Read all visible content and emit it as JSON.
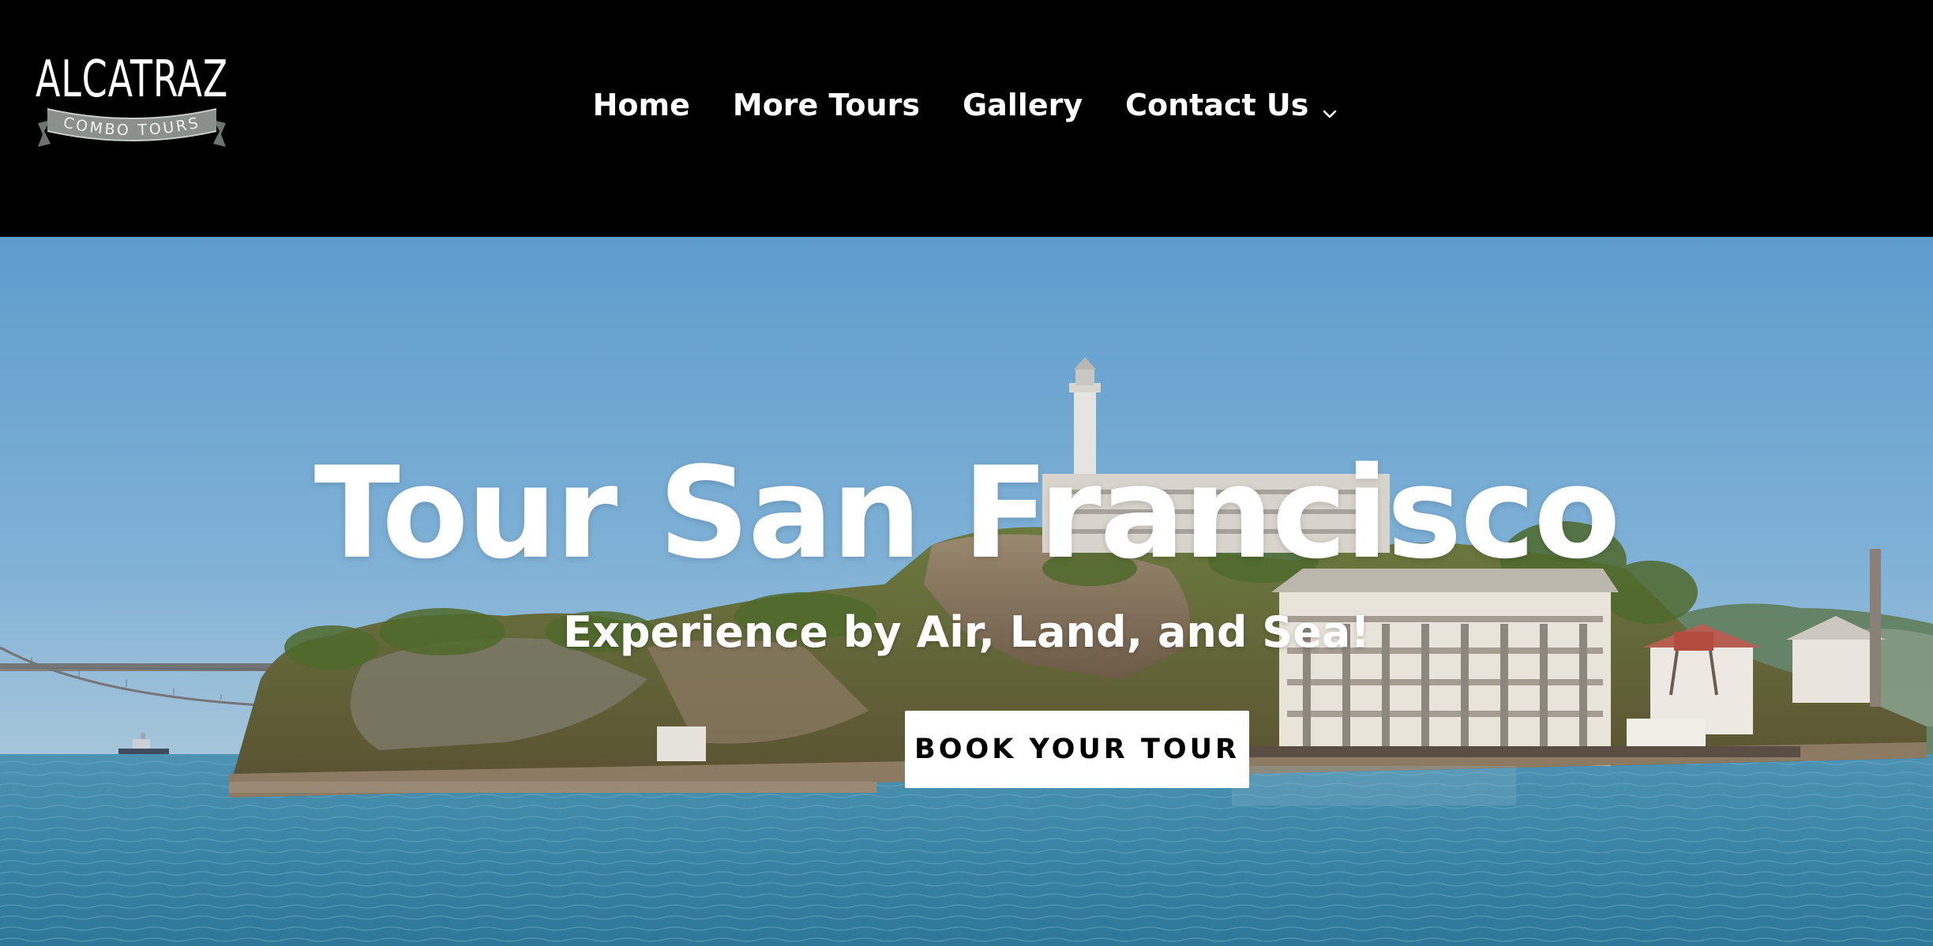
{
  "brand": {
    "logo_text": "ALCATRAZ",
    "logo_subtext": "COMBO TOURS"
  },
  "nav": {
    "items": [
      {
        "label": "Home"
      },
      {
        "label": "More Tours"
      },
      {
        "label": "Gallery"
      },
      {
        "label": "Contact Us",
        "has_dropdown": true,
        "icon": "chevron-down-icon"
      }
    ]
  },
  "hero": {
    "title": "Tour San Francisco",
    "subtitle": "Experience by Air, Land, and Sea!",
    "cta_label": "BOOK YOUR TOUR",
    "background": "alcatraz-island-photo"
  },
  "colors": {
    "header_bg": "#000000",
    "text_on_dark": "#ffffff",
    "button_bg": "#ffffff",
    "button_text": "#000000",
    "sky": "#5f9fce",
    "water": "#3b86a6"
  }
}
